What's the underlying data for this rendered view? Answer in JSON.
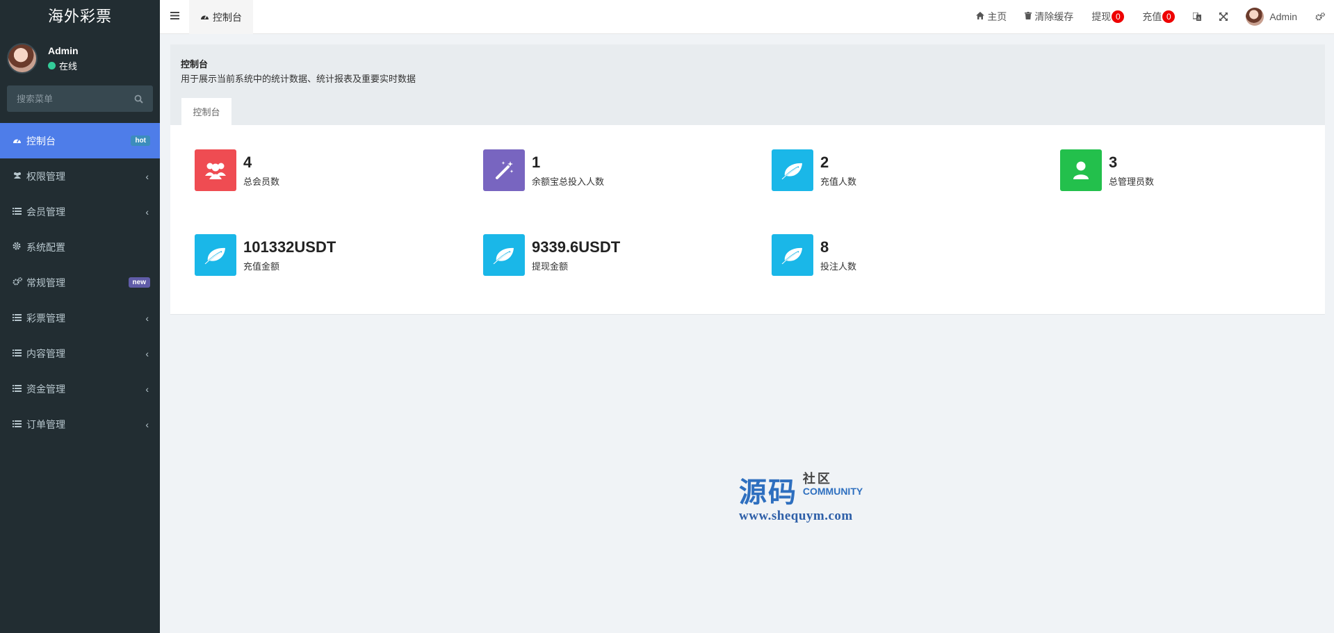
{
  "sidebar": {
    "brand": "海外彩票",
    "user": {
      "name": "Admin",
      "status": "在线"
    },
    "search_placeholder": "搜索菜单",
    "items": [
      {
        "label": "控制台",
        "badge": "hot"
      },
      {
        "label": "权限管理",
        "chevron": "‹"
      },
      {
        "label": "会员管理",
        "chevron": "‹"
      },
      {
        "label": "系统配置"
      },
      {
        "label": "常规管理",
        "badge": "new"
      },
      {
        "label": "彩票管理",
        "chevron": "‹"
      },
      {
        "label": "内容管理",
        "chevron": "‹"
      },
      {
        "label": "资金管理",
        "chevron": "‹"
      },
      {
        "label": "订单管理",
        "chevron": "‹"
      }
    ]
  },
  "header": {
    "tab_label": "控制台",
    "nav": {
      "home": "主页",
      "clear_cache": "清除缓存",
      "withdraw": "提现",
      "withdraw_count": "0",
      "recharge": "充值",
      "recharge_count": "0",
      "user": "Admin"
    }
  },
  "content": {
    "title": "控制台",
    "description": "用于展示当前系统中的统计数据、统计报表及重要实时数据",
    "tab": "控制台"
  },
  "stats": [
    {
      "value": "4",
      "label": "总会员数",
      "color": "#ef4c52",
      "icon": "users-icon"
    },
    {
      "value": "1",
      "label": "余额宝总投入人数",
      "color": "#7865c0",
      "icon": "magic-wand-icon"
    },
    {
      "value": "2",
      "label": "充值人数",
      "color": "#1ab7e8",
      "icon": "leaf-icon"
    },
    {
      "value": "3",
      "label": "总管理员数",
      "color": "#23c04c",
      "icon": "user-icon"
    },
    {
      "value": "101332USDT",
      "label": "充值金额",
      "color": "#1ab7e8",
      "icon": "leaf-icon"
    },
    {
      "value": "9339.6USDT",
      "label": "提现金额",
      "color": "#1ab7e8",
      "icon": "leaf-icon"
    },
    {
      "value": "8",
      "label": "投注人数",
      "color": "#1ab7e8",
      "icon": "leaf-icon"
    }
  ],
  "watermark": {
    "big": "源码",
    "cn": "社区",
    "en": "COMMUNITY",
    "url": "www.shequym.com"
  }
}
